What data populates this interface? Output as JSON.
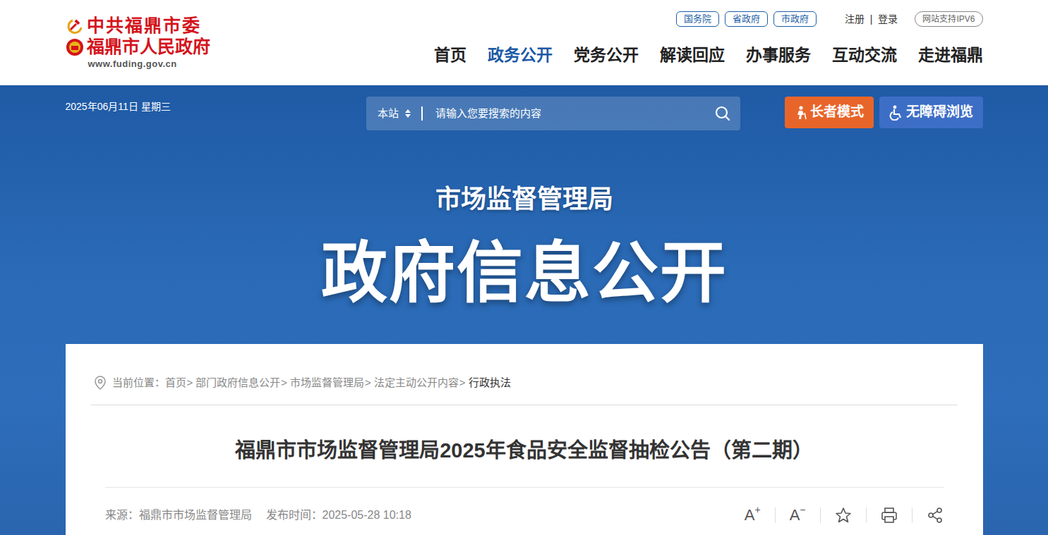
{
  "logo": {
    "line1": "中共福鼎市委",
    "line2": "福鼎市人民政府",
    "url": "www.fuding.gov.cn"
  },
  "top_links": [
    {
      "label": "国务院"
    },
    {
      "label": "省政府"
    },
    {
      "label": "市政府"
    }
  ],
  "account": {
    "items": [
      "注册",
      "登录"
    ],
    "separator": "|"
  },
  "ipv6": "网站支持IPV6",
  "nav": [
    {
      "label": "首页",
      "selected": false
    },
    {
      "label": "政务公开",
      "selected": true
    },
    {
      "label": "党务公开",
      "selected": false
    },
    {
      "label": "解读回应",
      "selected": false
    },
    {
      "label": "办事服务",
      "selected": false
    },
    {
      "label": "互动交流",
      "selected": false
    },
    {
      "label": "走进福鼎",
      "selected": false
    }
  ],
  "banner": {
    "date": "2025年06月11日 星期三",
    "search": {
      "scope": "本站",
      "placeholder": "请输入您要搜索的内容"
    },
    "buttons": [
      "长者模式",
      "无障碍浏览"
    ],
    "subtitle": "市场监督管理局",
    "title": "政府信息公开"
  },
  "breadcrumb": {
    "label": "当前位置：",
    "separator": ">",
    "items": [
      "首页",
      "部门政府信息公开",
      "市场监督管理局",
      "法定主动公开内容",
      "行政执法"
    ]
  },
  "article": {
    "title": "福鼎市市场监督管理局2025年食品安全监督抽检公告（第二期）",
    "source": "来源：福鼎市市场监督管理局",
    "published": "发布时间：2025-05-28 10:18",
    "tools": [
      {
        "label": "A",
        "mark": "+"
      },
      {
        "label": "A",
        "mark": "−"
      }
    ]
  }
}
